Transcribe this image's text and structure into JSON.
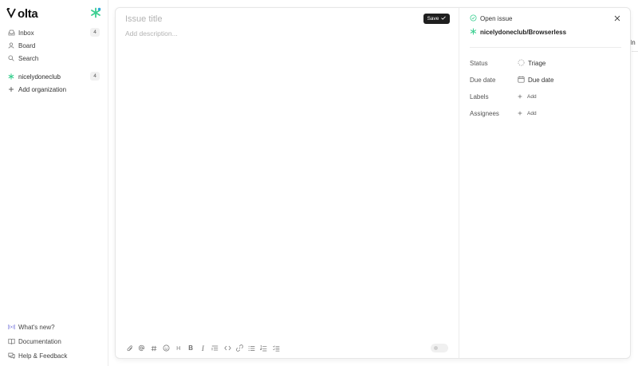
{
  "brand": {
    "name": "olta",
    "accent": "#3ccf91"
  },
  "sidebar": {
    "nav": [
      {
        "label": "Inbox",
        "icon": "inbox-icon",
        "count": "4"
      },
      {
        "label": "Board",
        "icon": "user-icon"
      },
      {
        "label": "Search",
        "icon": "search-icon"
      }
    ],
    "org": {
      "label": "nicelydoneclub",
      "count": "4"
    },
    "add_org_label": "Add organization",
    "footer": [
      {
        "label": "What's new?",
        "icon": "broadcast-icon"
      },
      {
        "label": "Documentation",
        "icon": "book-icon"
      },
      {
        "label": "Help & Feedback",
        "icon": "chat-icon"
      }
    ]
  },
  "background": {
    "partial_text": "In"
  },
  "modal": {
    "title_placeholder": "Issue title",
    "description_placeholder": "Add description...",
    "save_label": "Save",
    "toolbar_icons": [
      "attach-icon",
      "mention-icon",
      "hash-icon",
      "emoji-icon",
      "heading-icon",
      "bold-icon",
      "italic-icon",
      "quote-icon",
      "code-icon",
      "link-icon",
      "bullet-list-icon",
      "numbered-list-icon",
      "checklist-icon"
    ],
    "toolbar_heading_glyph": "H",
    "toolbar_bold_glyph": "B",
    "toolbar_italic_glyph": "I"
  },
  "panel": {
    "status_text": "Open issue",
    "repo": "nicelydoneclub/Browserless",
    "properties": {
      "status_label": "Status",
      "status_value": "Triage",
      "due_label": "Due date",
      "due_value": "Due date",
      "labels_label": "Labels",
      "labels_add": "Add",
      "assignees_label": "Assignees",
      "assignees_add": "Add"
    }
  }
}
